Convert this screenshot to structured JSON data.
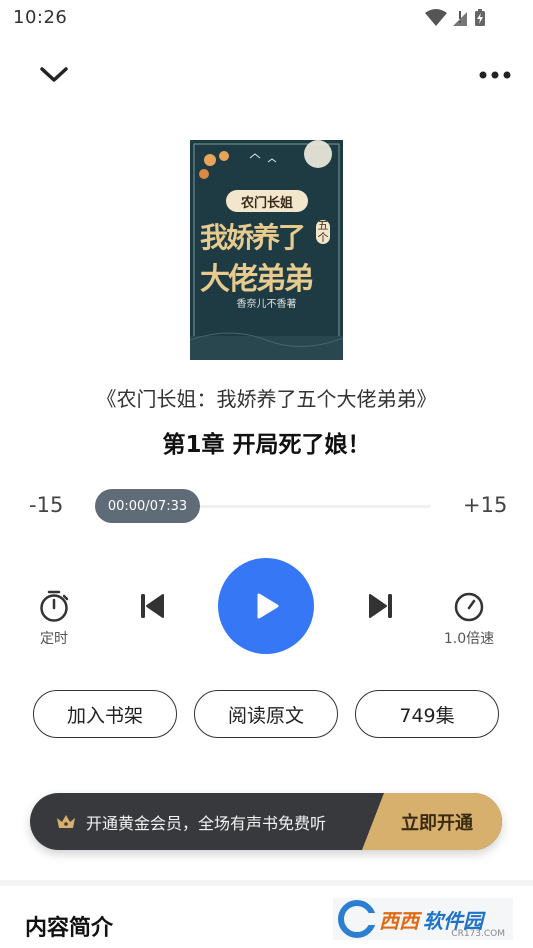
{
  "status_bar": {
    "time": "10:26"
  },
  "top_bar": {
    "collapse_icon": "chevron-down-icon",
    "more_icon": "more-dots-icon"
  },
  "cover": {
    "series": "农门长姐",
    "title_line1": "我娇养了",
    "title_small": "五个",
    "title_line2": "大佬弟弟",
    "author": "香奈儿不香著"
  },
  "book_title": "《农门长姐：我娇养了五个大佬弟弟》",
  "chapter_title": "第1章 开局死了娘！",
  "player": {
    "rewind_label": "-15",
    "forward_label": "+15",
    "time": "00:00/07:33",
    "progress": 0.0
  },
  "controls": {
    "timer_label": "定时",
    "speed_label": "1.0倍速"
  },
  "actions": [
    {
      "label": "加入书架"
    },
    {
      "label": "阅读原文"
    },
    {
      "label": "749集"
    }
  ],
  "vip": {
    "text": "开通黄金会员，全场有声书免费听",
    "button": "立即开通",
    "accent": "#d7b06d"
  },
  "section": {
    "title": "内容简介"
  },
  "watermark": {
    "text1": "西西",
    "text2": "软件园",
    "url": "CR173.COM"
  },
  "colors": {
    "play": "#3577f5",
    "pill": "#5f6b77",
    "banner": "#38393d"
  }
}
